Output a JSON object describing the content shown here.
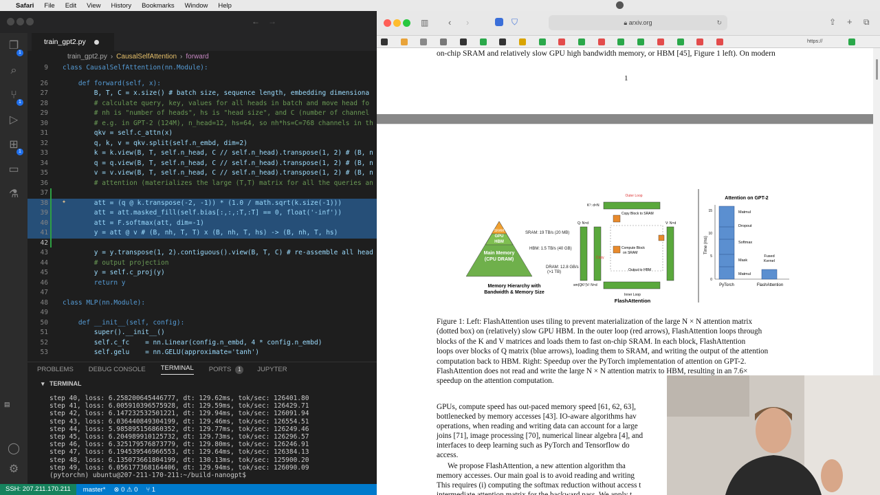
{
  "menubar": {
    "app": "Safari",
    "items": [
      "File",
      "Edit",
      "View",
      "History",
      "Bookmarks",
      "Window",
      "Help"
    ]
  },
  "vscode": {
    "tab": "train_gpt2.py",
    "breadcrumbs": [
      "train_gpt2.py",
      "›",
      "CausalSelfAttention",
      "›",
      "forward"
    ],
    "panel_tabs": [
      "PROBLEMS",
      "DEBUG CONSOLE",
      "TERMINAL",
      "PORTS",
      "JUPYTER"
    ],
    "ports_badge": "1",
    "terminal_header": "TERMINAL",
    "terminal_lines": [
      "step 40, loss: 6.258200645446777, dt: 129.62ms, tok/sec: 126401.80",
      "step 41, loss: 6.005910396575928, dt: 129.59ms, tok/sec: 126429.71",
      "step 42, loss: 6.147232532501221, dt: 129.94ms, tok/sec: 126091.94",
      "step 43, loss: 6.036440849304199, dt: 129.46ms, tok/sec: 126554.51",
      "step 44, loss: 5.985895156860352, dt: 129.77ms, tok/sec: 126249.46",
      "step 45, loss: 6.204989910125732, dt: 129.73ms, tok/sec: 126296.57",
      "step 46, loss: 6.325179576873779, dt: 129.80ms, tok/sec: 126246.91",
      "step 47, loss: 6.194539546966553, dt: 129.64ms, tok/sec: 126384.13",
      "step 48, loss: 6.135073661804199, dt: 130.13ms, tok/sec: 125900.20",
      "step 49, loss: 6.056177368164406, dt: 129.94ms, tok/sec: 126090.09",
      "(pytorchn) ubuntu@207-211-170-211:~/build-nanogpt$ "
    ],
    "status": {
      "remote": "SSH: 207.211.170.211",
      "branch": "master*",
      "problems": "⊗ 0 ⚠ 0",
      "ports": "⑂ 1"
    }
  },
  "code": [
    {
      "n": "9",
      "t": "class CausalSelfAttention(nn.Module):"
    },
    {
      "n": "26",
      "t": "    def forward(self, x):"
    },
    {
      "n": "27",
      "t": "        B, T, C = x.size() # batch size, sequence length, embedding dimensiona"
    },
    {
      "n": "28",
      "t": "        # calculate query, key, values for all heads in batch and move head fo"
    },
    {
      "n": "29",
      "t": "        # nh is \"number of heads\", hs is \"head size\", and C (number of channel"
    },
    {
      "n": "30",
      "t": "        # e.g. in GPT-2 (124M), n_head=12, hs=64, so nh*hs=C=768 channels in th"
    },
    {
      "n": "31",
      "t": "        qkv = self.c_attn(x)"
    },
    {
      "n": "32",
      "t": "        q, k, v = qkv.split(self.n_embd, dim=2)"
    },
    {
      "n": "33",
      "t": "        k = k.view(B, T, self.n_head, C // self.n_head).transpose(1, 2) # (B, n"
    },
    {
      "n": "34",
      "t": "        q = q.view(B, T, self.n_head, C // self.n_head).transpose(1, 2) # (B, n"
    },
    {
      "n": "35",
      "t": "        v = v.view(B, T, self.n_head, C // self.n_head).transpose(1, 2) # (B, n"
    },
    {
      "n": "36",
      "t": "        # attention (materializes the large (T,T) matrix for all the queries an"
    },
    {
      "n": "37",
      "t": ""
    },
    {
      "n": "38",
      "t": "        att = (q @ k.transpose(-2, -1)) * (1.0 / math.sqrt(k.size(-1)))"
    },
    {
      "n": "39",
      "t": "        att = att.masked_fill(self.bias[:,:,:T,:T] == 0, float('-inf'))"
    },
    {
      "n": "40",
      "t": "        att = F.softmax(att, dim=-1)"
    },
    {
      "n": "41",
      "t": "        y = att @ v # (B, nh, T, T) x (B, nh, T, hs) -> (B, nh, T, hs)"
    },
    {
      "n": "42",
      "t": ""
    },
    {
      "n": "43",
      "t": "        y = y.transpose(1, 2).contiguous().view(B, T, C) # re-assemble all head"
    },
    {
      "n": "44",
      "t": "        # output projection"
    },
    {
      "n": "45",
      "t": "        y = self.c_proj(y)"
    },
    {
      "n": "46",
      "t": "        return y"
    },
    {
      "n": "47",
      "t": ""
    },
    {
      "n": "48",
      "t": "class MLP(nn.Module):"
    },
    {
      "n": "49",
      "t": ""
    },
    {
      "n": "50",
      "t": "    def __init__(self, config):"
    },
    {
      "n": "51",
      "t": "        super().__init__()"
    },
    {
      "n": "52",
      "t": "        self.c_fc    = nn.Linear(config.n_embd, 4 * config.n_embd)"
    },
    {
      "n": "53",
      "t": "        self.gelu    = nn.GELU(approximate='tanh')"
    }
  ],
  "safari": {
    "url": "arxiv.org",
    "fav_last": "https://"
  },
  "paper": {
    "top_line": "on-chip SRAM and relatively slow GPU high bandwidth memory, or HBM [45], Figure 1 left). On modern",
    "page_number": "1",
    "fig": {
      "outer_loop": "Outer Loop",
      "kt": "Kᵀ: d×N",
      "copy_block_sram": "Copy Block to SRAM",
      "q": "Q: N×d",
      "v": "V: N×d",
      "copy": "Copy",
      "compute_block": "Compute Block",
      "on_sram": "on SRAM",
      "output_hbm": "Output to HBM",
      "inner_loop": "Inner Loop",
      "sm": "sm(QKᵀ)V: N×d",
      "flash": "FlashAttention",
      "sram": "SRAM",
      "hbm": "HBM",
      "gpu": "GPU",
      "main_mem": "Main Memory",
      "cpu_dram": "(CPU DRAM)",
      "sram_bw": "SRAM: 19 TB/s (20 MB)",
      "hbm_bw": "HBM: 1.5 TB/s (40 GB)",
      "dram_bw": "DRAM: 12.8 GB/s",
      "dram_sz": "(>1 TB)",
      "hier1": "Memory Hierarchy with",
      "hier2": "Bandwidth & Memory Size",
      "bar_title": "Attention on GPT-2",
      "ylabel": "Time (ms)",
      "segs": [
        "Matmul",
        "Dropout",
        "Softmax",
        "Mask",
        "Matmul"
      ],
      "fused1": "Fused",
      "fused2": "Kernel",
      "yt": [
        "15",
        "10",
        "5",
        "0"
      ],
      "xcats": [
        "PyTorch",
        "FlashAttention"
      ]
    },
    "caption": [
      "Figure 1: Left: FlashAttention uses tiling to prevent materialization of the large N × N attention matrix",
      "(dotted box) on (relatively) slow GPU HBM. In the outer loop (red arrows), FlashAttention loops through",
      "blocks of the K and V matrices and loads them to fast on-chip SRAM. In each block, FlashAttention",
      "loops over blocks of Q matrix (blue arrows), loading them to SRAM, and writing the output of the attention",
      "computation back to HBM. Right: Speedup over the PyTorch implementation of attention on GPT-2.",
      "FlashAttention does not read and write the large N × N attention matrix to HBM, resulting in an 7.6×",
      "speedup on the attention computation."
    ],
    "body": [
      "GPUs, compute speed has out-paced memory speed [61, 62, 63],",
      "bottlenecked by memory accesses [43]. IO-aware algorithms hav",
      "operations, when reading and writing data can account for a large",
      "joins [71], image processing [70], numerical linear algebra [4], and",
      "interfaces to deep learning such as PyTorch and Tensorflow do",
      "access.",
      "We propose FlashAttention, a new attention algorithm tha",
      "memory accesses. Our main goal is to avoid reading and writing",
      "This requires (i) computing the softmax reduction without access t",
      "intermediate attention matrix for the backward pass. We apply t"
    ]
  }
}
